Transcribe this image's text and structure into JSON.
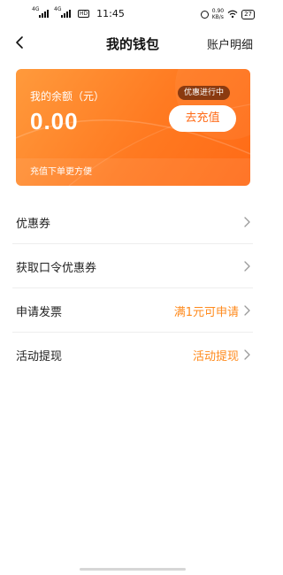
{
  "status_bar": {
    "signal1_tag": "4G",
    "signal2_tag": "4G",
    "hd_badge": "HD",
    "time": "11:45",
    "net_speed_value": "0.90",
    "net_speed_unit": "KB/s",
    "battery": "27"
  },
  "nav": {
    "title": "我的钱包",
    "right_link": "账户明细"
  },
  "wallet": {
    "balance_label": "我的余额（元）",
    "balance_value": "0.00",
    "promo_badge": "优惠进行中",
    "recharge_button": "去充值",
    "note": "充值下单更方便",
    "accent_color": "#ff7a21"
  },
  "menu": {
    "items": [
      {
        "label": "优惠券",
        "value": ""
      },
      {
        "label": "获取口令优惠券",
        "value": ""
      },
      {
        "label": "申请发票",
        "value": "满1元可申请"
      },
      {
        "label": "活动提现",
        "value": "活动提现"
      }
    ],
    "value_color": "#ff8a1c"
  },
  "icons": {
    "back": "back-arrow-icon",
    "chevron": "chevron-right-icon"
  }
}
